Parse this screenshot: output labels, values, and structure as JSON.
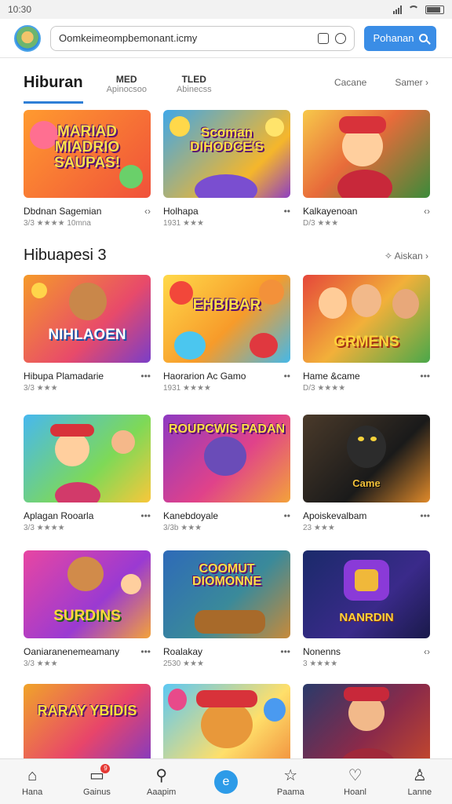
{
  "status_bar": {
    "time": "10:30"
  },
  "top_bar": {
    "url": "Oomkeimeompbemonant.icmy",
    "search_button_label": "Pohanan"
  },
  "tabs": {
    "active": "Hiburan",
    "items": [
      {
        "title": "MED",
        "subtitle": "Apinocsoo"
      },
      {
        "title": "TLED",
        "subtitle": "Abinecss"
      }
    ],
    "right_links": [
      "Cacane",
      "Samer"
    ]
  },
  "sections": [
    {
      "title": "",
      "see_all": ""
    },
    {
      "title": "Hibuapesi 3",
      "see_all": "Aiskan"
    }
  ],
  "cards": [
    {
      "art_text": "MARIAD MIADRIO SAUPAS!",
      "name": "Dbdnan Sagemian",
      "meta": "3/3 ★★★★ 10mna"
    },
    {
      "art_text": "Scoman DIHODCE'S",
      "name": "Holhapa",
      "meta": "1931 ★★★"
    },
    {
      "art_text": "",
      "name": "Kalkayenoan",
      "meta": "D/3 ★★★"
    },
    {
      "art_text": "NIHLAOEN",
      "name": "Hibupa Plamadarie",
      "meta": "3/3 ★★★"
    },
    {
      "art_text": "EHBIBAR",
      "name": "Haorarion Ac Gamo",
      "meta": "1931 ★★★★"
    },
    {
      "art_text": "GRMENS",
      "name": "Hame &came",
      "meta": "D/3 ★★★★"
    },
    {
      "art_text": "",
      "name": "Aplagan Rooarla",
      "meta": "3/3 ★★★★"
    },
    {
      "art_text": "ROUPCWIS PADAN",
      "name": "Kanebdoyale",
      "meta": "3/3b ★★★"
    },
    {
      "art_text": "Came",
      "name": "Apoiskevalbam",
      "meta": "23 ★★★"
    },
    {
      "art_text": "SURDINS",
      "name": "Oaniaranenemeamany",
      "meta": "3/3 ★★★"
    },
    {
      "art_text": "COOMUT DIOMONNE",
      "name": "Roalakay",
      "meta": "2530 ★★★"
    },
    {
      "art_text": "NANRDIN",
      "name": "Nonenns",
      "meta": "3 ★★★★"
    },
    {
      "art_text": "RARAY YBIDIS",
      "name": "",
      "meta": ""
    },
    {
      "art_text": "",
      "name": "",
      "meta": ""
    },
    {
      "art_text": "",
      "name": "",
      "meta": ""
    }
  ],
  "bottom_nav": [
    {
      "label": "Hana",
      "icon": "home-icon"
    },
    {
      "label": "Gainus",
      "icon": "chat-icon",
      "badge": "9"
    },
    {
      "label": "Aaapim",
      "icon": "search-icon"
    },
    {
      "label": "",
      "icon": "browser-icon"
    },
    {
      "label": "Paama",
      "icon": "star-icon"
    },
    {
      "label": "Hoanl",
      "icon": "heart-icon"
    },
    {
      "label": "Lanne",
      "icon": "user-icon"
    }
  ]
}
